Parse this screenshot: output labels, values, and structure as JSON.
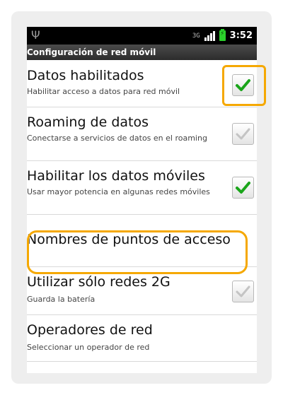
{
  "status_bar": {
    "time": "3:52",
    "network_type": "3G"
  },
  "title_bar": {
    "title": "Configuración de red móvil"
  },
  "settings": [
    {
      "title": "Datos habilitados",
      "summary": "Habilitar acceso a datos para red móvil",
      "checked": true
    },
    {
      "title": "Roaming de datos",
      "summary": "Conectarse a servicios de datos en el roaming",
      "checked": false
    },
    {
      "title": "Habilitar los datos móviles",
      "summary": "Usar mayor potencia en algunas redes móviles",
      "checked": true
    },
    {
      "title": "Nombres de puntos de acceso"
    },
    {
      "title": "Utilizar sólo redes 2G",
      "summary": "Guarda la batería",
      "checked": false
    },
    {
      "title": "Operadores de red",
      "summary": "Seleccionar un operador de red"
    }
  ],
  "colors": {
    "highlight": "#f5a800",
    "check_on": "#1aa51a",
    "check_off": "#c4c4c4"
  }
}
